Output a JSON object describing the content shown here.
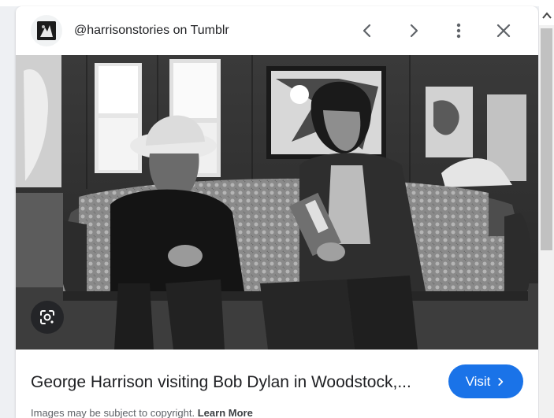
{
  "header": {
    "source": "@harrisonstories on Tumblr",
    "favicon_icon": "tumblr-avatar-icon",
    "prev_icon": "chevron-left-icon",
    "next_icon": "chevron-right-icon",
    "more_icon": "more-vert-icon",
    "close_icon": "close-icon"
  },
  "image": {
    "lens_icon": "google-lens-icon"
  },
  "result": {
    "caption": "George Harrison visiting Bob Dylan in Woodstock,...",
    "visit_label": "Visit",
    "visit_icon": "chevron-right-icon"
  },
  "footer": {
    "copyright_text": "Images may be subject to copyright.",
    "learn_more": "Learn More"
  },
  "colors": {
    "accent": "#1a73e8",
    "text": "#202124",
    "muted": "#5f6368"
  }
}
